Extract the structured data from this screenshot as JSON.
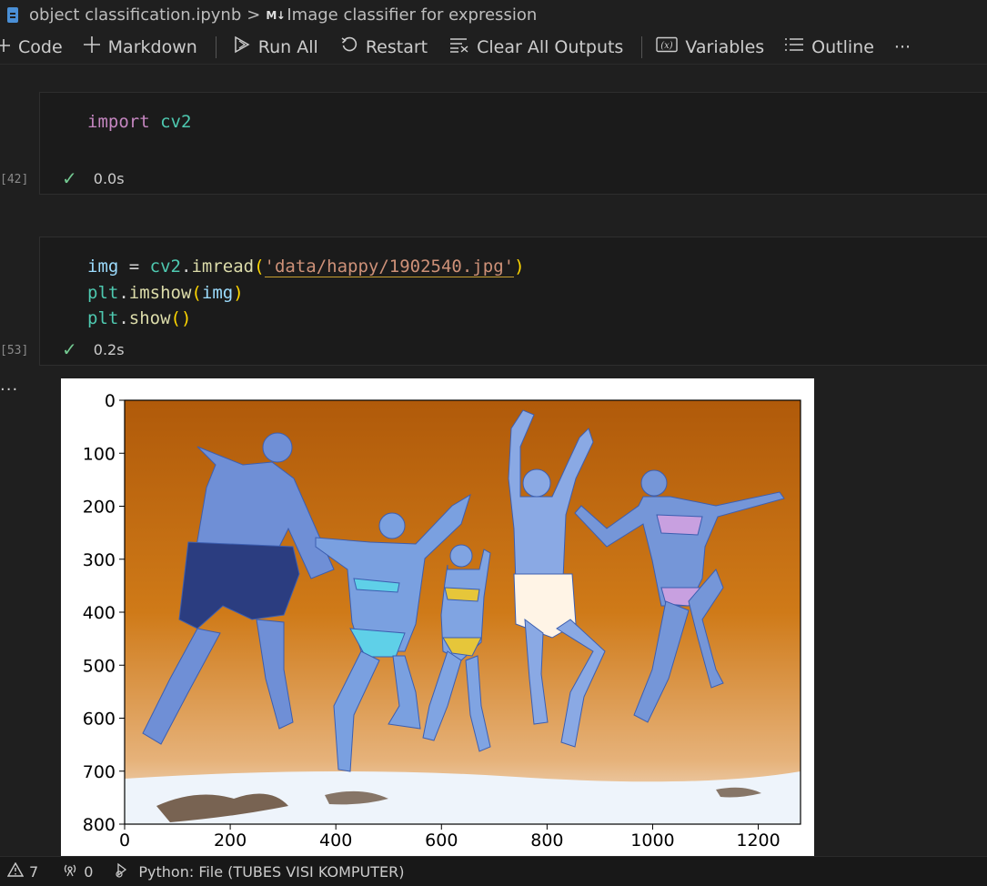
{
  "breadcrumb": {
    "file_icon": "notebook-file-icon",
    "file_name": "object classification.ipynb",
    "separator": ">",
    "section_icon": "M↓",
    "section_title": "Image classifier for expression"
  },
  "toolbar": {
    "code_label": "Code",
    "markdown_label": "Markdown",
    "run_all_label": "Run All",
    "restart_label": "Restart",
    "clear_outputs_label": "Clear All Outputs",
    "variables_label": "Variables",
    "outline_label": "Outline",
    "more_label": "···"
  },
  "cells": [
    {
      "execution_count": "[42]",
      "status_time": "0.0s",
      "code": {
        "kw": "import",
        "module": "cv2"
      }
    },
    {
      "execution_count": "[53]",
      "status_time": "0.2s",
      "code": {
        "var_img": "img",
        "eq": " = ",
        "cv2": "cv2",
        "dot": ".",
        "imread": "imread",
        "lparen": "(",
        "path": "'data/happy/1902540.jpg'",
        "rparen": ")",
        "plt": "plt",
        "imshow": "imshow",
        "img_arg": "img",
        "show": "show",
        "empty_parens": "()"
      }
    }
  ],
  "output_more": "···",
  "figure": {
    "xticks": [
      "0",
      "200",
      "400",
      "600",
      "800",
      "1000",
      "1200"
    ],
    "yticks": [
      "0",
      "100",
      "200",
      "300",
      "400",
      "500",
      "600",
      "700",
      "800"
    ],
    "image_description_icon": "beach-jump-photo"
  },
  "statusbar": {
    "warnings_icon": "warning-icon",
    "warnings": "7",
    "ports_icon": "broadcast-icon",
    "ports": "0",
    "kernel_icon": "python-kernel-icon",
    "kernel": "Python: File (TUBES VISI KOMPUTER)"
  },
  "colors": {
    "background": "#1f1f1f",
    "cell_bg": "#1b1b1b",
    "keyword": "#c586c0",
    "module": "#4ec9b0",
    "string": "#ce9178",
    "function": "#dcdcaa",
    "check": "#73c991"
  }
}
